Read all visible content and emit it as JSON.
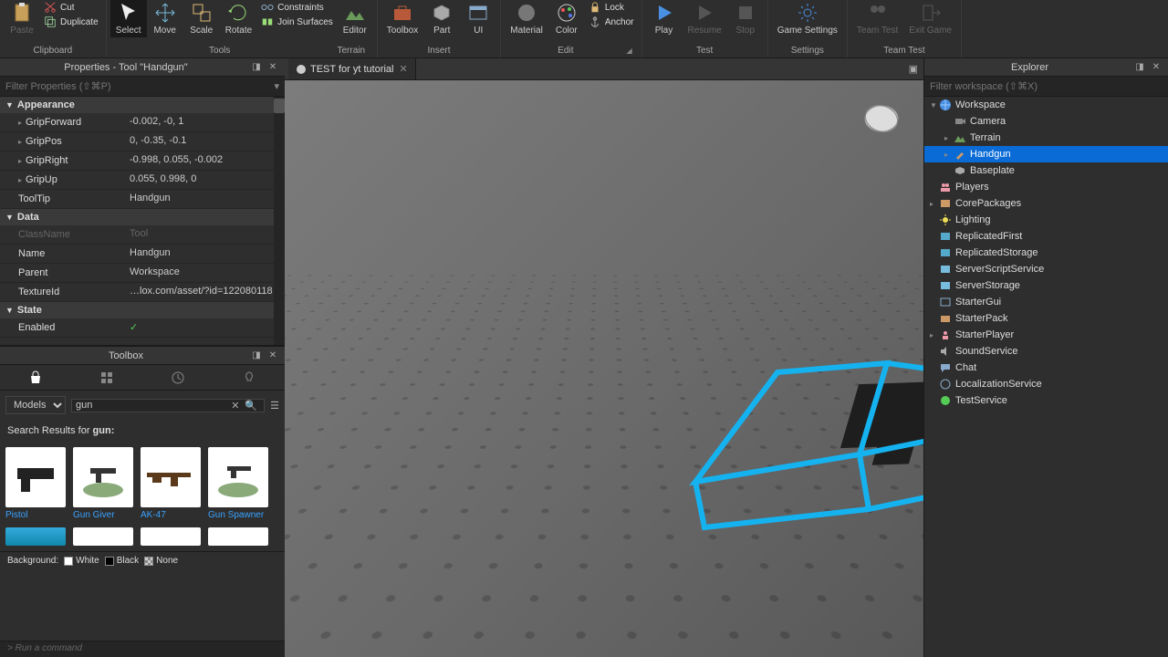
{
  "ribbon": {
    "clipboard": {
      "label": "Clipboard",
      "paste": "Paste",
      "cut": "Cut",
      "duplicate": "Duplicate"
    },
    "tools": {
      "label": "Tools",
      "items": [
        "Select",
        "Move",
        "Scale",
        "Rotate"
      ],
      "constraints": "Constraints",
      "join": "Join Surfaces",
      "editor": "Editor"
    },
    "terrain": {
      "label": "Terrain"
    },
    "insert": {
      "label": "Insert",
      "items": [
        "Toolbox",
        "Part",
        "UI"
      ]
    },
    "edit": {
      "label": "Edit",
      "items": [
        "Material",
        "Color"
      ],
      "lock": "Lock",
      "anchor": "Anchor"
    },
    "test": {
      "label": "Test",
      "items": [
        "Play",
        "Resume",
        "Stop"
      ]
    },
    "settings": {
      "label": "Settings",
      "items": [
        "Game Settings"
      ]
    },
    "teamtest": {
      "label": "Team Test",
      "items": [
        "Team Test",
        "Exit Game"
      ]
    }
  },
  "properties": {
    "title": "Properties - Tool \"Handgun\"",
    "filter_placeholder": "Filter Properties (⇧⌘P)",
    "appearance": {
      "label": "Appearance",
      "GripForward": "-0.002, -0, 1",
      "GripPos": "0, -0.35, -0.1",
      "GripRight": "-0.998, 0.055, -0.002",
      "GripUp": "0.055, 0.998, 0",
      "ToolTip": "Handgun"
    },
    "data": {
      "label": "Data",
      "ClassName": "Tool",
      "Name": "Handgun",
      "Parent": "Workspace",
      "TextureId": "…lox.com/asset/?id=122080118"
    },
    "state": {
      "label": "State",
      "Enabled": "✓"
    }
  },
  "toolbox": {
    "title": "Toolbox",
    "category": "Models",
    "query": "gun",
    "results_label": "Search Results for ",
    "results_term": "gun:",
    "items": [
      "Pistol",
      "Gun Giver",
      "AK-47",
      "Gun Spawner"
    ],
    "bg_label": "Background:",
    "bg_options": [
      "White",
      "Black",
      "None"
    ]
  },
  "tab": {
    "name": "TEST for yt tutorial"
  },
  "explorer": {
    "title": "Explorer",
    "filter_placeholder": "Filter workspace (⇧⌘X)",
    "tree": {
      "workspace": "Workspace",
      "camera": "Camera",
      "terrain": "Terrain",
      "handgun": "Handgun",
      "baseplate": "Baseplate",
      "players": "Players",
      "corepackages": "CorePackages",
      "lighting": "Lighting",
      "repfirst": "ReplicatedFirst",
      "repstorage": "ReplicatedStorage",
      "serverscript": "ServerScriptService",
      "serverstorage": "ServerStorage",
      "startergui": "StarterGui",
      "starterpack": "StarterPack",
      "starterplayer": "StarterPlayer",
      "soundservice": "SoundService",
      "chat": "Chat",
      "localization": "LocalizationService",
      "testservice": "TestService"
    }
  },
  "command": {
    "placeholder": "Run a command"
  },
  "colors": {
    "selection": "#0a6bd6",
    "wire": "#15b2f0"
  }
}
